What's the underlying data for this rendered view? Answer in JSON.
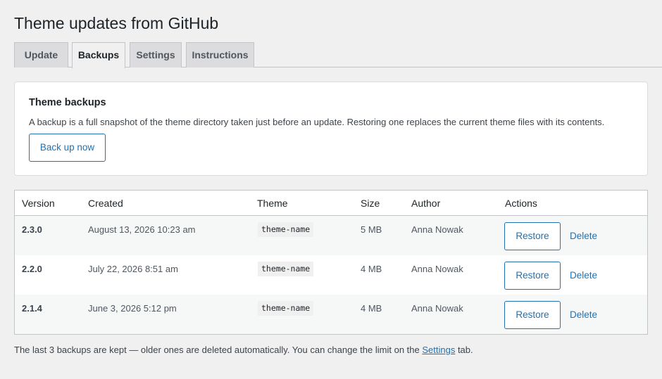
{
  "page": {
    "title": "Theme updates from GitHub"
  },
  "tabs": [
    {
      "label": "Update",
      "active": false
    },
    {
      "label": "Backups",
      "active": true
    },
    {
      "label": "Settings",
      "active": false
    },
    {
      "label": "Instructions",
      "active": false
    }
  ],
  "backups_card": {
    "title": "Theme backups",
    "description": "A backup is a full snapshot of the theme directory taken just before an update. Restoring one replaces the current theme files with its contents.",
    "backup_button": "Back up now"
  },
  "table": {
    "headers": [
      "Version",
      "Created",
      "Theme",
      "Size",
      "Author",
      "Actions"
    ],
    "rows": [
      {
        "version": "2.3.0",
        "created": "August 13, 2026 10:23 am",
        "theme": "theme-name",
        "size": "5 MB",
        "author": "Anna Nowak",
        "restore": "Restore",
        "delete": "Delete"
      },
      {
        "version": "2.2.0",
        "created": "July 22, 2026 8:51 am",
        "theme": "theme-name",
        "size": "4 MB",
        "author": "Anna Nowak",
        "restore": "Restore",
        "delete": "Delete"
      },
      {
        "version": "2.1.4",
        "created": "June 3, 2026 5:12 pm",
        "theme": "theme-name",
        "size": "4 MB",
        "author": "Anna Nowak",
        "restore": "Restore",
        "delete": "Delete"
      }
    ]
  },
  "footnote": {
    "before": "The last 3 backups are kept — older ones are deleted automatically. You can change the limit on the ",
    "link": "Settings",
    "after": " tab."
  },
  "colors": {
    "accent": "#2271b1",
    "background": "#f0f0f1",
    "text": "#1d2327"
  }
}
